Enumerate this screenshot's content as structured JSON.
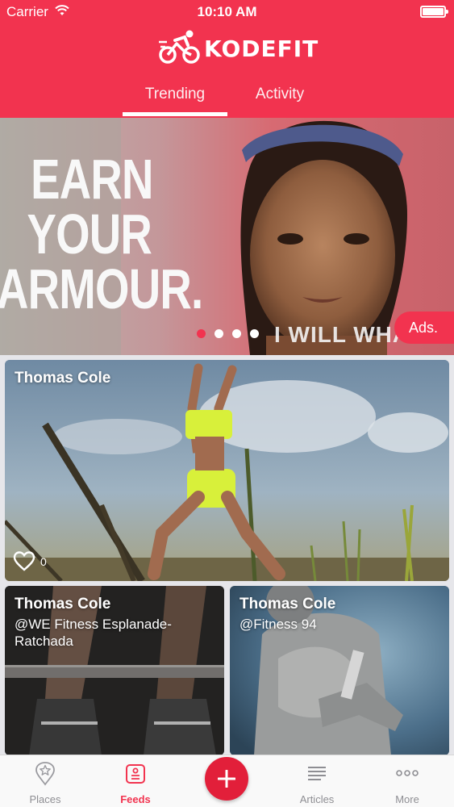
{
  "status_bar": {
    "carrier": "Carrier",
    "time": "10:10 AM"
  },
  "header": {
    "logo_text": "KODEFIT",
    "tabs": [
      {
        "label": "Trending",
        "active": true
      },
      {
        "label": "Activity",
        "active": false
      }
    ],
    "background_color": "#f2334f"
  },
  "banner": {
    "headline_line1": "EARN",
    "headline_line2": "YOUR",
    "headline_line3": "ARMOUR.",
    "tagline": "I WILL WHA",
    "ads_label": "Ads.",
    "carousel": {
      "page_count": 4,
      "active_index": 0
    }
  },
  "feed": {
    "cards": [
      {
        "name": "Thomas Cole",
        "location": "",
        "likes": "0"
      },
      {
        "name": "Thomas Cole",
        "location": "@WE Fitness Esplanade-Ratchada"
      },
      {
        "name": "Thomas Cole",
        "location": "@Fitness 94"
      }
    ]
  },
  "bottom_nav": {
    "items": [
      {
        "label": "Places",
        "icon": "map-pin-star-icon",
        "active": false
      },
      {
        "label": "Feeds",
        "icon": "feed-card-icon",
        "active": true
      },
      {
        "label": "Articles",
        "icon": "text-lines-icon",
        "active": false
      },
      {
        "label": "More",
        "icon": "more-dots-icon",
        "active": false
      }
    ],
    "fab_icon": "plus-icon"
  }
}
